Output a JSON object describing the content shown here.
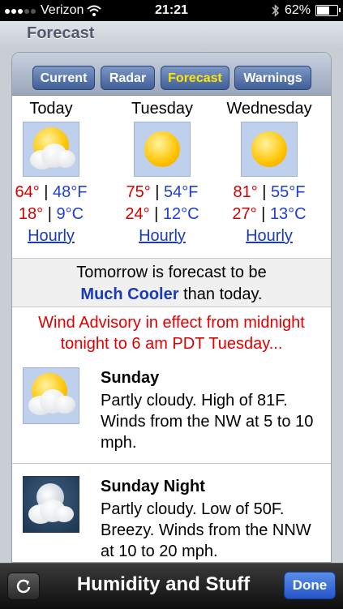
{
  "status": {
    "carrier": "Verizon",
    "time": "21:21",
    "battery": "62%",
    "battery_level": 0.62,
    "bluetooth_icon": "bluetooth-icon",
    "wifi_icon": "wifi-icon"
  },
  "header": {
    "title": "Forecast"
  },
  "tabs": [
    {
      "label": "Current"
    },
    {
      "label": "Radar"
    },
    {
      "label": "Forecast"
    },
    {
      "label": "Warnings"
    }
  ],
  "active_tab": "Forecast",
  "days": [
    {
      "name": "Today",
      "icon": "partly-cloudy-icon",
      "hi_f": "64°",
      "lo_f": "48°F",
      "hi_c": "18°",
      "lo_c": "9°C",
      "link": "Hourly"
    },
    {
      "name": "Tuesday",
      "icon": "sunny-icon",
      "hi_f": "75°",
      "lo_f": "54°F",
      "hi_c": "24°",
      "lo_c": "12°C",
      "link": "Hourly"
    },
    {
      "name": "Wednesday",
      "icon": "sunny-icon",
      "hi_f": "81°",
      "lo_f": "55°F",
      "hi_c": "27°",
      "lo_c": "13°C",
      "link": "Hourly"
    }
  ],
  "separator": "|",
  "tomorrow": {
    "line1": "Tomorrow is forecast to be",
    "change": "Much Cooler",
    "suffix": "than today."
  },
  "advisory": {
    "text": "Wind Advisory in effect from midnight tonight to 6 am PDT Tuesday..."
  },
  "forecasts": [
    {
      "title": "Sunday",
      "icon": "partly-cloudy-icon",
      "text": "Partly cloudy. High of 81F. Winds from the NW at 5 to 10 mph."
    },
    {
      "title": "Sunday Night",
      "icon": "partly-cloudy-night-icon",
      "text": "Partly cloudy. Low of 50F. Breezy. Winds from the NNW at 10 to 20 mph."
    }
  ],
  "bottom": {
    "title": "Humidity and Stuff",
    "done": "Done",
    "refresh_icon": "refresh-icon"
  },
  "colors": {
    "hi": "#d10000",
    "lo": "#1f3fcf",
    "link": "#1a3bb8",
    "advisory": "#e00000",
    "active_tab": "#ffe600"
  }
}
